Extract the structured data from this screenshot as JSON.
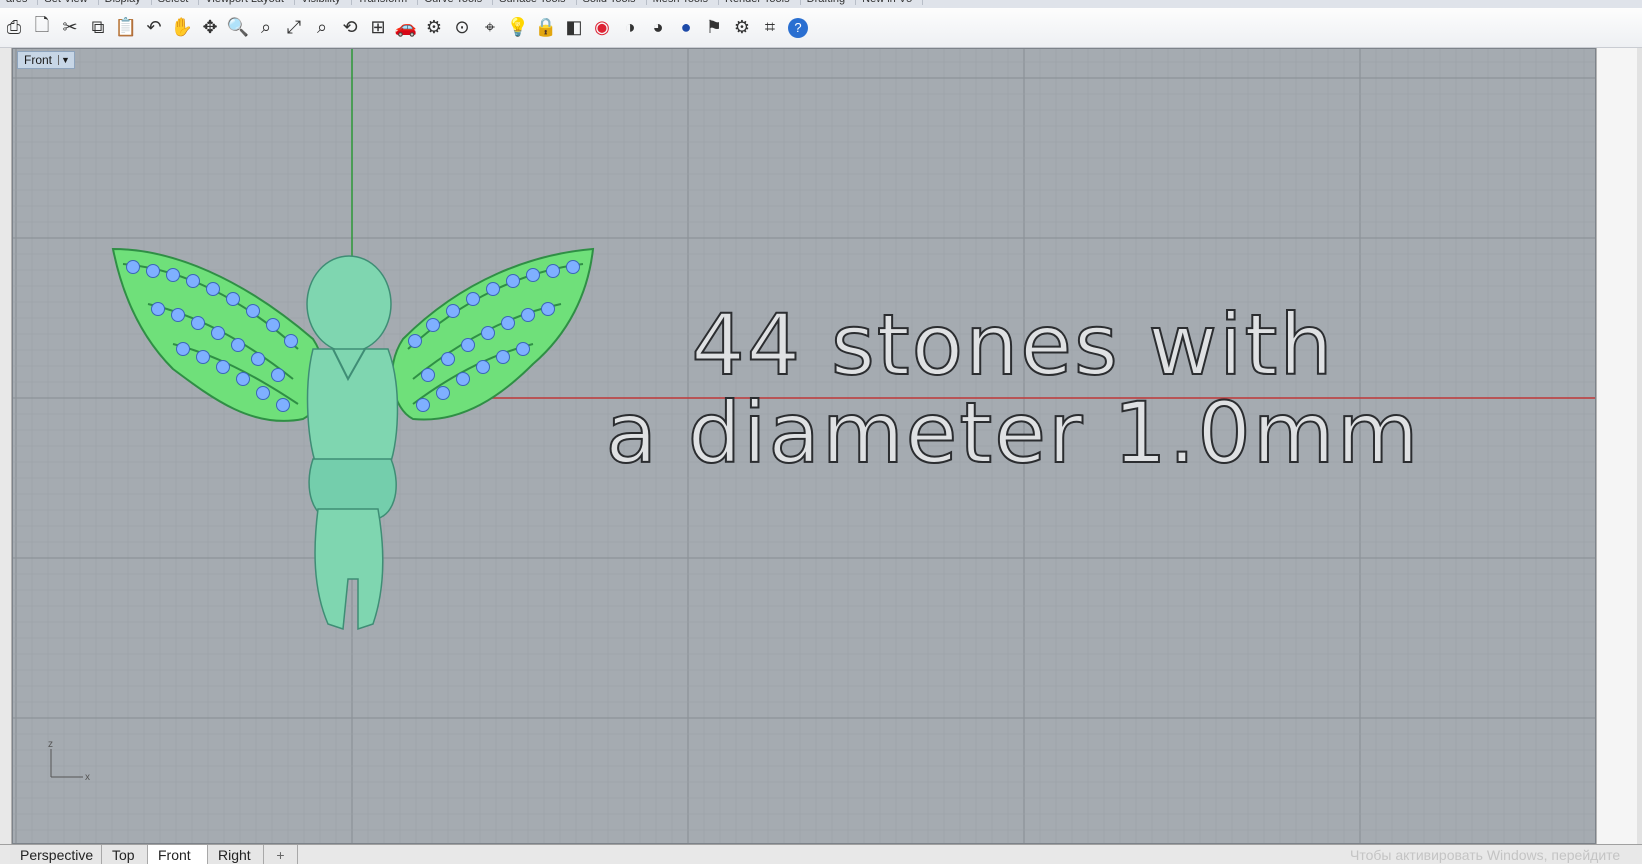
{
  "toolbar_tabs": [
    "ares",
    "Set View",
    "Display",
    "Select",
    "Viewport Layout",
    "Visibility",
    "Transform",
    "Curve Tools",
    "Surface Tools",
    "Solid Tools",
    "Mesh Tools",
    "Render Tools",
    "Drafting",
    "New in V5"
  ],
  "toolbar_icons": [
    "print-icon",
    "new-icon",
    "cut-icon",
    "copy-icon",
    "paste-icon",
    "undo-icon",
    "pan-hand-icon",
    "move-icon",
    "zoom-icon",
    "zoom-window-icon",
    "zoom-extents-icon",
    "zoom-selected-icon",
    "rotate-view-icon",
    "four-viewports-icon",
    "car-icon",
    "properties-icon",
    "point-icon",
    "snap-icon",
    "lightbulb-icon",
    "lock-icon",
    "layer-icon",
    "color-wheel-icon",
    "shade-icon",
    "render-sphere-icon",
    "material-sphere-icon",
    "filter-icon",
    "settings-icon",
    "grid-snap-icon",
    "help-icon"
  ],
  "viewport": {
    "label": "Front",
    "overlay_line1": "44 stones with",
    "overlay_line2": "a diameter 1.0mm",
    "axis_z": "z",
    "axis_x": "x"
  },
  "bottom_tabs": [
    "Perspective",
    "Top",
    "Front",
    "Right"
  ],
  "active_tab": "Front",
  "add_tab_symbol": "+",
  "watermark": "Чтобы активировать Windows, перейдите",
  "colors": {
    "viewport_bg": "#a5abb1",
    "grid_minor": "#9aa0a6",
    "grid_major": "#8d9399",
    "x_axis": "#c0393b",
    "z_axis": "#2f9a3a",
    "model_body": "#7fd6b0",
    "wing_highlight": "#6fe07a",
    "stone": "#7fb0ff"
  }
}
